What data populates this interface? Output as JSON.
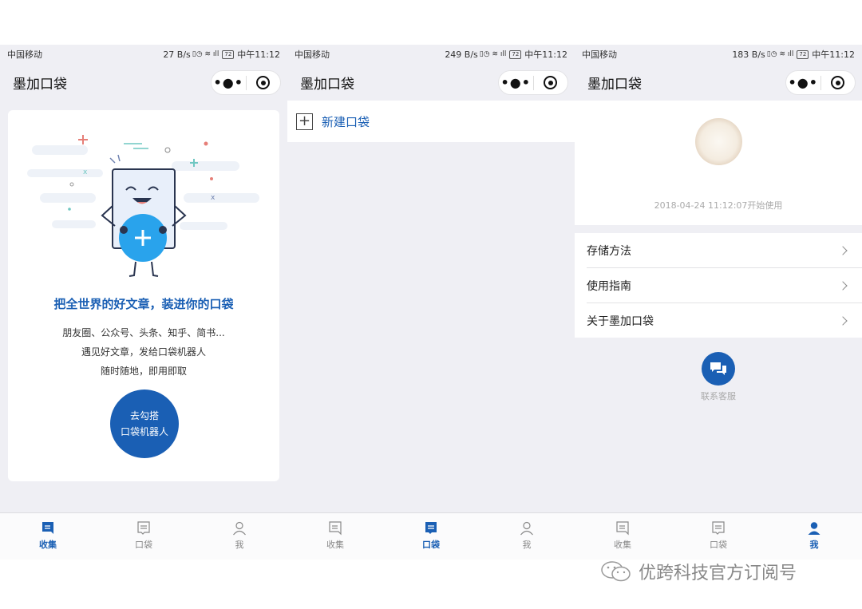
{
  "status": {
    "carrier": "中国移动",
    "time": "中午11:12",
    "battery": "72",
    "speeds": [
      "27 B/s",
      "249 B/s",
      "183 B/s"
    ]
  },
  "nav": {
    "title": "墨加口袋",
    "more": "•●•"
  },
  "tabs": [
    "收集",
    "口袋",
    "我"
  ],
  "collect": {
    "headline": "把全世界的好文章，装进你的口袋",
    "lines": [
      "朋友圈、公众号、头条、知乎、简书...",
      "遇见好文章，发给口袋机器人",
      "随时随地，即用即取"
    ],
    "cta": [
      "去勾搭",
      "口袋机器人"
    ]
  },
  "pocket": {
    "new_label": "新建口袋",
    "plus": "+"
  },
  "me": {
    "since": "2018-04-24 11:12:07开始使用",
    "menu": [
      "存储方法",
      "使用指南",
      "关于墨加口袋"
    ],
    "support_label": "联系客服"
  },
  "watermark": "优跨科技官方订阅号",
  "colors": {
    "accent": "#1a5fb4",
    "background": "#efeff4"
  }
}
